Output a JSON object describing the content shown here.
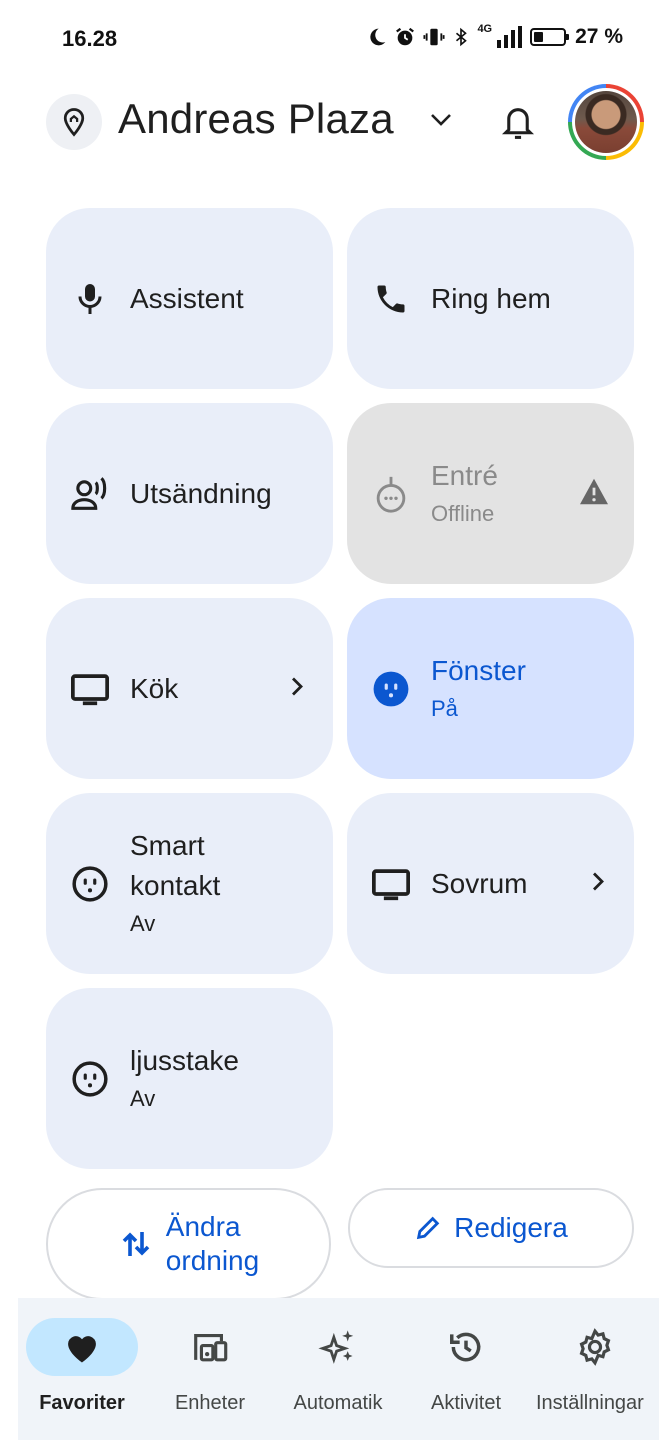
{
  "status_bar": {
    "time": "16.28",
    "network": "4G",
    "battery": "27 %"
  },
  "header": {
    "home_name": "Andreas Plaza"
  },
  "tiles": [
    {
      "label": "Assistent",
      "icon": "mic-icon"
    },
    {
      "label": "Ring hem",
      "icon": "phone-icon"
    },
    {
      "label": "Utsändning",
      "icon": "broadcast-icon"
    },
    {
      "label": "Entré",
      "status": "Offline",
      "icon": "doorbell-icon"
    },
    {
      "label": "Kök",
      "icon": "tv-icon"
    },
    {
      "label": "Fönster",
      "status": "På",
      "icon": "outlet-icon"
    },
    {
      "label": "Smart",
      "label2": "kontakt",
      "status": "Av",
      "icon": "outlet-icon"
    },
    {
      "label": "Sovrum",
      "icon": "tv-icon"
    },
    {
      "label": "ljusstake",
      "status": "Av",
      "icon": "outlet-icon"
    }
  ],
  "actions": {
    "reorder_line1": "Ändra",
    "reorder_line2": "ordning",
    "edit": "Redigera"
  },
  "nav": [
    {
      "label": "Favoriter",
      "icon": "heart-icon",
      "active": true
    },
    {
      "label": "Enheter",
      "icon": "devices-icon"
    },
    {
      "label": "Automatik",
      "icon": "sparkle-icon"
    },
    {
      "label": "Aktivitet",
      "icon": "history-icon"
    },
    {
      "label": "Inställningar",
      "icon": "gear-icon"
    }
  ],
  "colors": {
    "accent": "#0b57d0",
    "tile_bg": "#e9eef9",
    "tile_on_bg": "#d6e2ff",
    "tile_offline_bg": "#e3e3e3",
    "nav_active": "#c2e7ff"
  }
}
